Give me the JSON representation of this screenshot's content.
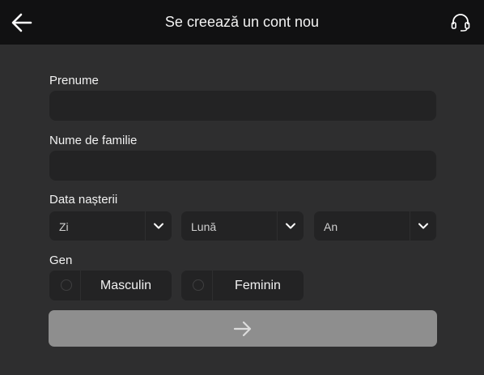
{
  "header": {
    "title": "Se creează un cont nou",
    "back_icon": "arrow-left-icon",
    "support_icon": "headset-icon"
  },
  "form": {
    "first_name": {
      "label": "Prenume",
      "value": "",
      "placeholder": ""
    },
    "last_name": {
      "label": "Nume de familie",
      "value": "",
      "placeholder": ""
    },
    "birth_date": {
      "label": "Data nașterii",
      "day": "Zi",
      "month": "Lună",
      "year": "An"
    },
    "gender": {
      "label": "Gen",
      "options": [
        "Masculin",
        "Feminin"
      ]
    },
    "submit_icon": "arrow-right-icon"
  },
  "colors": {
    "background": "#2e2e2f",
    "header": "#111112",
    "field": "#232324",
    "submit_disabled": "#8e8e8e"
  }
}
